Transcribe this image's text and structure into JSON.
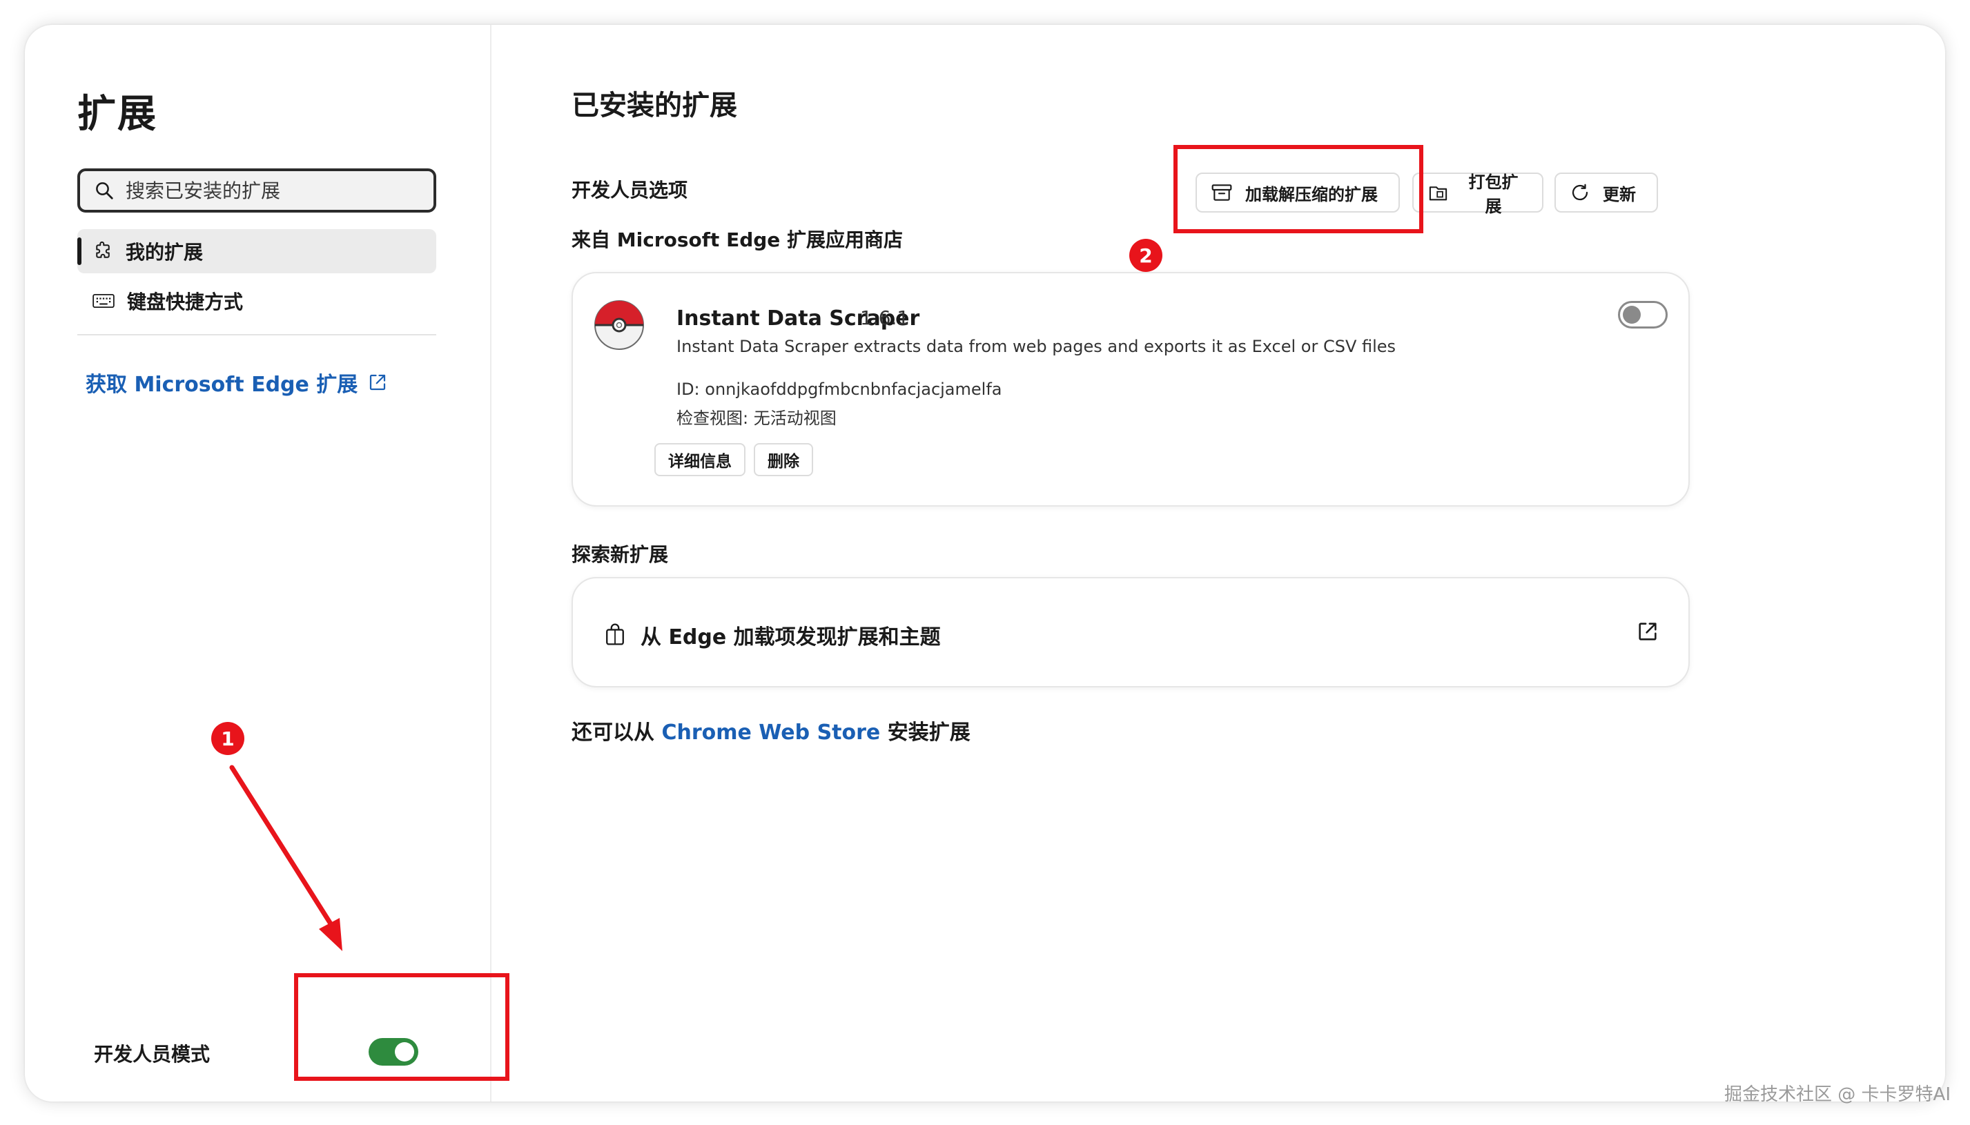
{
  "sidebar": {
    "title": "扩展",
    "search_placeholder": "搜索已安装的扩展",
    "items": [
      {
        "label": "我的扩展",
        "icon": "puzzle-icon",
        "active": true
      },
      {
        "label": "键盘快捷方式",
        "icon": "keyboard-icon",
        "active": false
      }
    ],
    "get_extensions_link": "获取 Microsoft Edge 扩展",
    "developer_mode_label": "开发人员模式",
    "developer_mode_on": true
  },
  "main": {
    "title": "已安装的扩展",
    "developer_options_label": "开发人员选项",
    "toolbar": {
      "load_unpacked": "加载解压缩的扩展",
      "pack": "打包扩展",
      "update": "更新"
    },
    "from_store_label": "来自 Microsoft Edge 扩展应用商店",
    "extension": {
      "name": "Instant Data Scraper",
      "version": "1.6.1",
      "description": "Instant Data Scraper extracts data from web pages and exports it as Excel or CSV files",
      "id_line": "ID: onnjkaofddpgfmbcnbnfacjacjamelfa",
      "inspect_line": "检查视图: 无活动视图",
      "details_button": "详细信息",
      "remove_button": "删除",
      "enabled": false
    },
    "explore_title": "探索新扩展",
    "discover_text": "从 Edge 加载项发现扩展和主题",
    "also_prefix": "还可以从 ",
    "also_link": "Chrome Web Store",
    "also_suffix": " 安装扩展"
  },
  "annotations": {
    "badge_1": "1",
    "badge_2": "2",
    "color": "#e8141b"
  },
  "watermark": "掘金技术社区 @ 卡卡罗特AI",
  "colors": {
    "toggle_on": "#2e8b3e",
    "link": "#1a5fb4"
  }
}
